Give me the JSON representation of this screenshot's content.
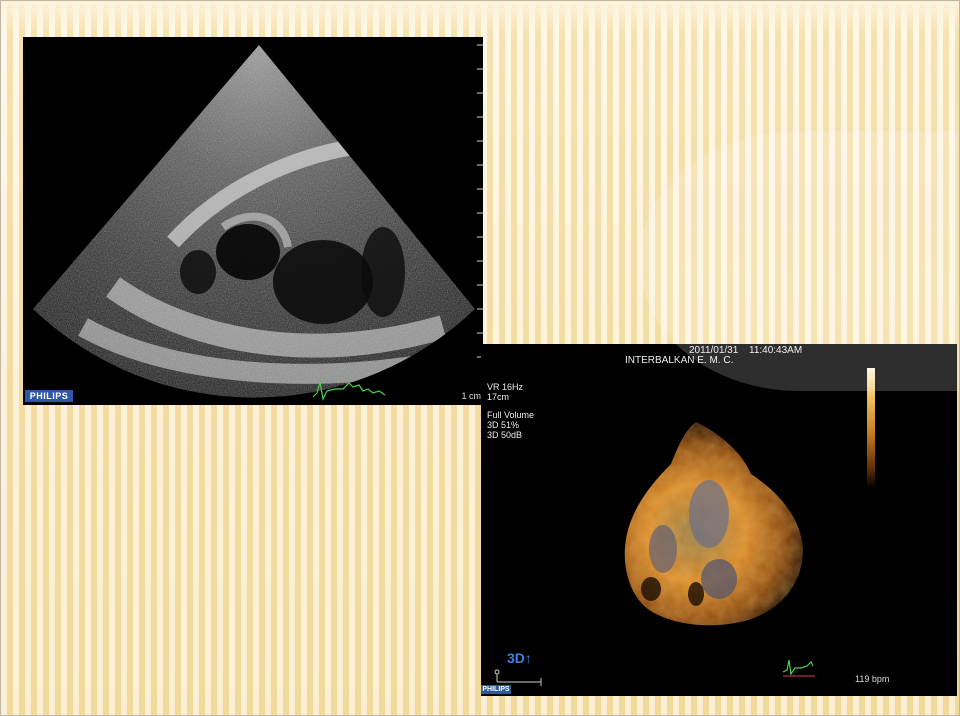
{
  "panel_2d": {
    "logo": "PHILIPS",
    "scale": "1 cm"
  },
  "panel_3d": {
    "date": "2011/01/31",
    "time": "11:40:43AM",
    "institution": "INTERBALKAN E. M. C.",
    "params": {
      "vr": "VR 16Hz",
      "depth": "17cm",
      "mode_name": "Full Volume",
      "opacity": "3D 51%",
      "gain": "3D 50dB"
    },
    "mode_label": "3D↑",
    "logo": "PHILIPS",
    "heart_rate": "119 bpm"
  },
  "colors": {
    "slide_bg": "#f8e2ad",
    "logo_blue": "#2d56a8",
    "ecg_green": "#4fd24f",
    "volume_orange": "#d98a2a"
  }
}
